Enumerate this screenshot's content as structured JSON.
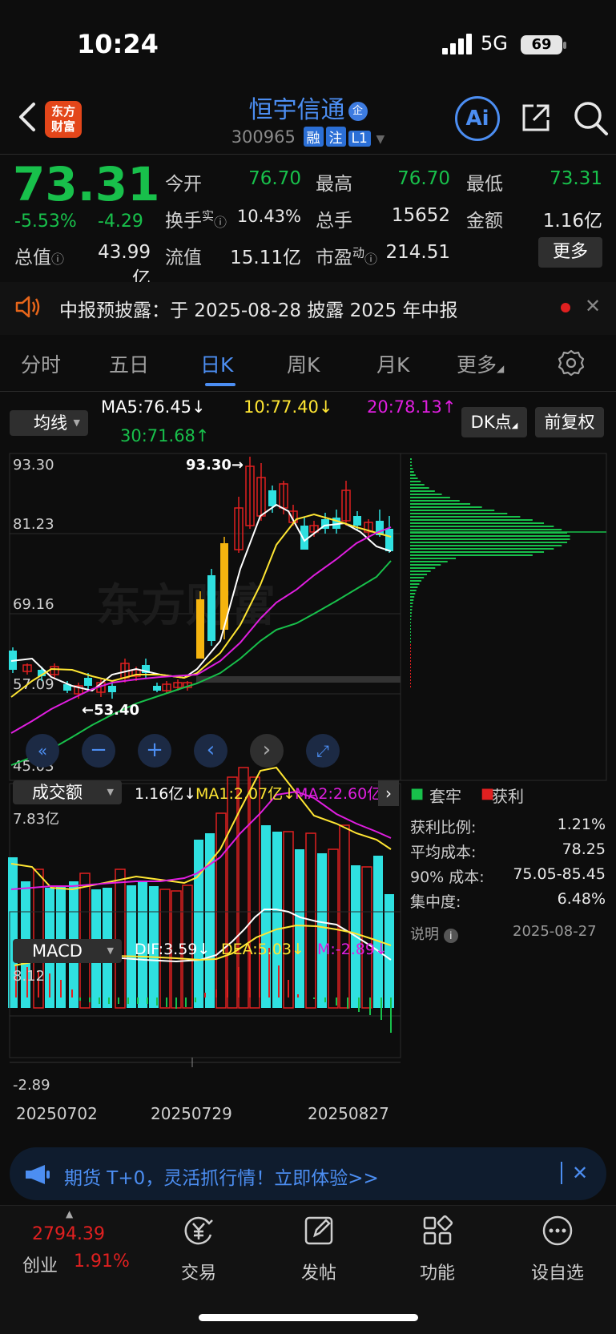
{
  "status_bar": {
    "time": "10:24",
    "network": "5G",
    "battery": "69"
  },
  "header": {
    "logo_text": "东方\n财富",
    "stock_name": "恒宇信通",
    "badge": "企",
    "code": "300965",
    "tags": [
      "融",
      "注",
      "L1"
    ]
  },
  "quote": {
    "price": "73.31",
    "change_pct": "-5.53%",
    "change": "-4.29",
    "fields": [
      {
        "label": "今开",
        "value": "76.70",
        "color": "green"
      },
      {
        "label": "最高",
        "value": "76.70",
        "color": "green"
      },
      {
        "label": "最低",
        "value": "73.31",
        "color": "green"
      },
      {
        "label": "换手",
        "sup": "实",
        "value": "10.43%",
        "color": "white"
      },
      {
        "label": "总手",
        "value": "15652",
        "color": "white"
      },
      {
        "label": "金额",
        "value": "1.16亿",
        "color": "white"
      },
      {
        "label": "总值",
        "value": "43.99亿",
        "color": "white"
      },
      {
        "label": "流值",
        "value": "15.11亿",
        "color": "white"
      },
      {
        "label": "市盈",
        "sup": "动",
        "value": "214.51",
        "color": "white"
      }
    ],
    "more_button": "更多"
  },
  "notice": {
    "text": "中报预披露：于 2025-08-28 披露 2025 年中报"
  },
  "tabs": {
    "items": [
      "分时",
      "五日",
      "日K",
      "周K",
      "月K",
      "更多"
    ],
    "active_index": 2
  },
  "kline": {
    "indicator_dropdown": "均线",
    "ma5": "MA5:76.45↓",
    "ma10": "10:77.40↓",
    "ma20": "20:78.13↑",
    "ma30": "30:71.68↑",
    "dk_button": "DK点",
    "adjust_button": "前复权",
    "y_labels": [
      "93.30",
      "81.23",
      "69.16",
      "57.09",
      "45.03"
    ],
    "high_marker": "93.30→",
    "low_marker": "←53.40",
    "watermark": "东方财富"
  },
  "volume": {
    "dropdown": "成交额",
    "current": "1.16亿↓",
    "ma1": "MA1:2.07亿↓",
    "ma2": "MA2:2.60亿",
    "top_label": "7.83亿"
  },
  "macd": {
    "dropdown": "MACD",
    "dif": "DIF:3.59↓",
    "dea": "DEA:5.03↓",
    "m": "M:-2.89↓",
    "top_label": "8.12",
    "bottom_label": "-2.89"
  },
  "x_axis": {
    "dates": [
      "20250702",
      "20250729",
      "20250827"
    ]
  },
  "chip": {
    "legend_trapped": "套牢",
    "legend_profit": "获利",
    "stats": [
      {
        "k": "获利比例:",
        "v": "1.21%"
      },
      {
        "k": "平均成本:",
        "v": "78.25"
      },
      {
        "k": "90% 成本:",
        "v": "75.05-85.45"
      },
      {
        "k": "集中度:",
        "v": "6.48%"
      }
    ],
    "note_label": "说明",
    "date": "2025-08-27"
  },
  "banner": {
    "text": "期货 T+0，灵活抓行情！立即体验>>"
  },
  "bottom_nav": {
    "index_value": "2794.39",
    "index_name": "创业",
    "index_change": "1.91%",
    "items": [
      "交易",
      "发帖",
      "功能",
      "设自选"
    ]
  },
  "colors": {
    "up": "#e02020",
    "down": "#18c04b",
    "accent": "#4c8ef2",
    "ma5": "#ffffff",
    "ma10": "#ffe633",
    "ma20": "#e01ee0",
    "ma30": "#18c04b",
    "bear_body": "#2fe0e0",
    "bull_fill_big": "#f5b40f"
  },
  "chart_data": {
    "type": "candlestick",
    "title": "",
    "ylim": [
      45.03,
      93.3
    ],
    "x": [
      "20250702",
      "20250729",
      "20250827"
    ],
    "max_price": 93.3,
    "min_price": 53.4,
    "ma_values": {
      "MA5": 76.45,
      "MA10": 77.4,
      "MA20": 78.13,
      "MA30": 71.68
    },
    "volume_axis_max": "7.83亿",
    "macd": {
      "DIF": 3.59,
      "DEA": 5.03,
      "M": -2.89,
      "ylim": [
        -2.89,
        8.12
      ]
    }
  }
}
